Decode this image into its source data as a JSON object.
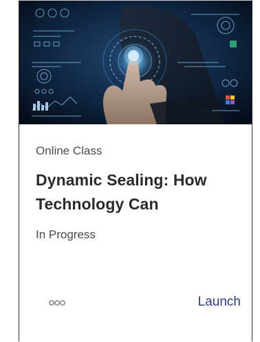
{
  "card": {
    "type_label": "Online Class",
    "title": "Dynamic Sealing: How Technology Can",
    "status": "In Progress",
    "more_icon": "more-dots-icon",
    "launch_label": "Launch",
    "thumbnail_icon": "touch-technology-image"
  },
  "colors": {
    "link": "#2b3d7d",
    "text": "#4a4a4a",
    "title": "#2a2a2a",
    "thumb_bg": "#0a1a33",
    "thumb_glow": "#3fa9f5"
  }
}
